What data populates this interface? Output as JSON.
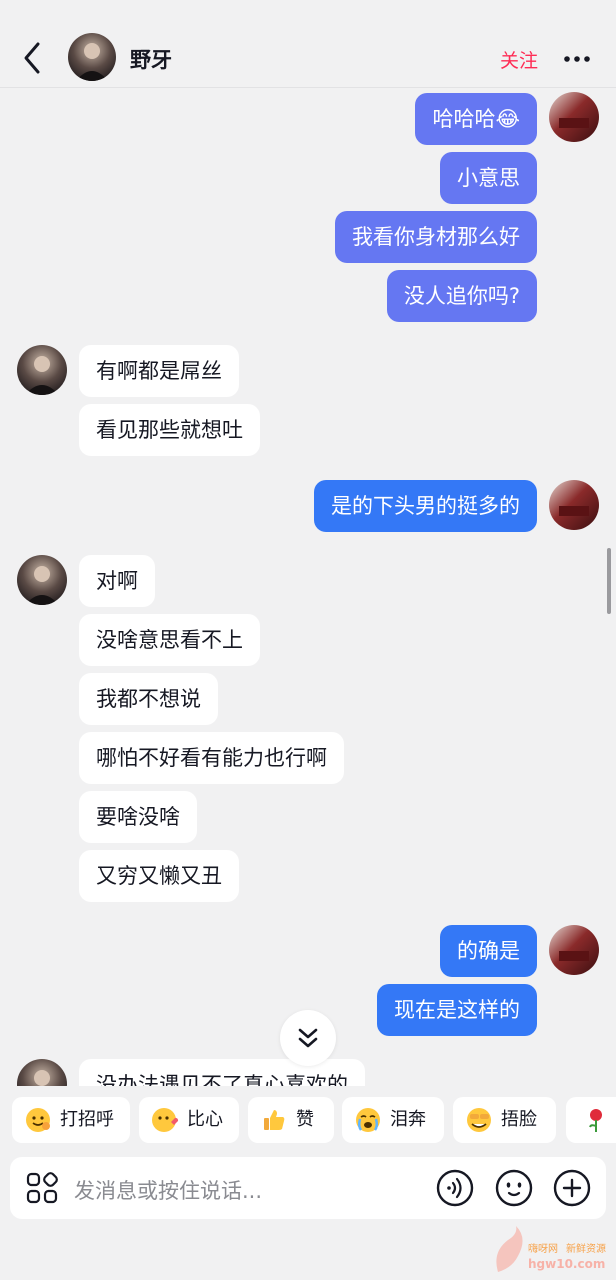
{
  "header": {
    "name": "野牙",
    "follow_label": "关注"
  },
  "messages": [
    {
      "side": "out",
      "text": "哈哈哈😂"
    },
    {
      "side": "out",
      "text": "小意思"
    },
    {
      "side": "out",
      "text": "我看你身材那么好"
    },
    {
      "side": "out",
      "text": "没人追你吗?"
    },
    {
      "side": "in",
      "text": "有啊都是屌丝"
    },
    {
      "side": "in",
      "text": "看见那些就想吐"
    },
    {
      "side": "out",
      "text": "是的下头男的挺多的"
    },
    {
      "side": "in",
      "text": "对啊"
    },
    {
      "side": "in",
      "text": "没啥意思看不上"
    },
    {
      "side": "in",
      "text": "我都不想说"
    },
    {
      "side": "in",
      "text": "哪怕不好看有能力也行啊"
    },
    {
      "side": "in",
      "text": "要啥没啥"
    },
    {
      "side": "in",
      "text": "又穷又懒又丑"
    },
    {
      "side": "out",
      "text": "的确是"
    },
    {
      "side": "out",
      "text": "现在是这样的"
    },
    {
      "side": "in",
      "text": "没办法遇见不了真心喜欢的"
    }
  ],
  "quick_replies": [
    {
      "label": "打招呼",
      "icon": "waving-face-icon"
    },
    {
      "label": "比心",
      "icon": "heart-hands-icon"
    },
    {
      "label": "赞",
      "icon": "thumbs-up-icon"
    },
    {
      "label": "泪奔",
      "icon": "crying-face-icon"
    },
    {
      "label": "捂脸",
      "icon": "facepalm-face-icon"
    },
    {
      "label": "",
      "icon": "rose-icon"
    }
  ],
  "input": {
    "placeholder": "发消息或按住说话..."
  },
  "watermark": {
    "line1": "嗨呀网",
    "line2": "新鲜资源",
    "domain": "hgw10.com"
  },
  "colors": {
    "accent_follow": "#fe2c55",
    "outgoing_bubble": "#3478f6",
    "incoming_bubble": "#ffffff",
    "background": "#f1f1f2"
  }
}
